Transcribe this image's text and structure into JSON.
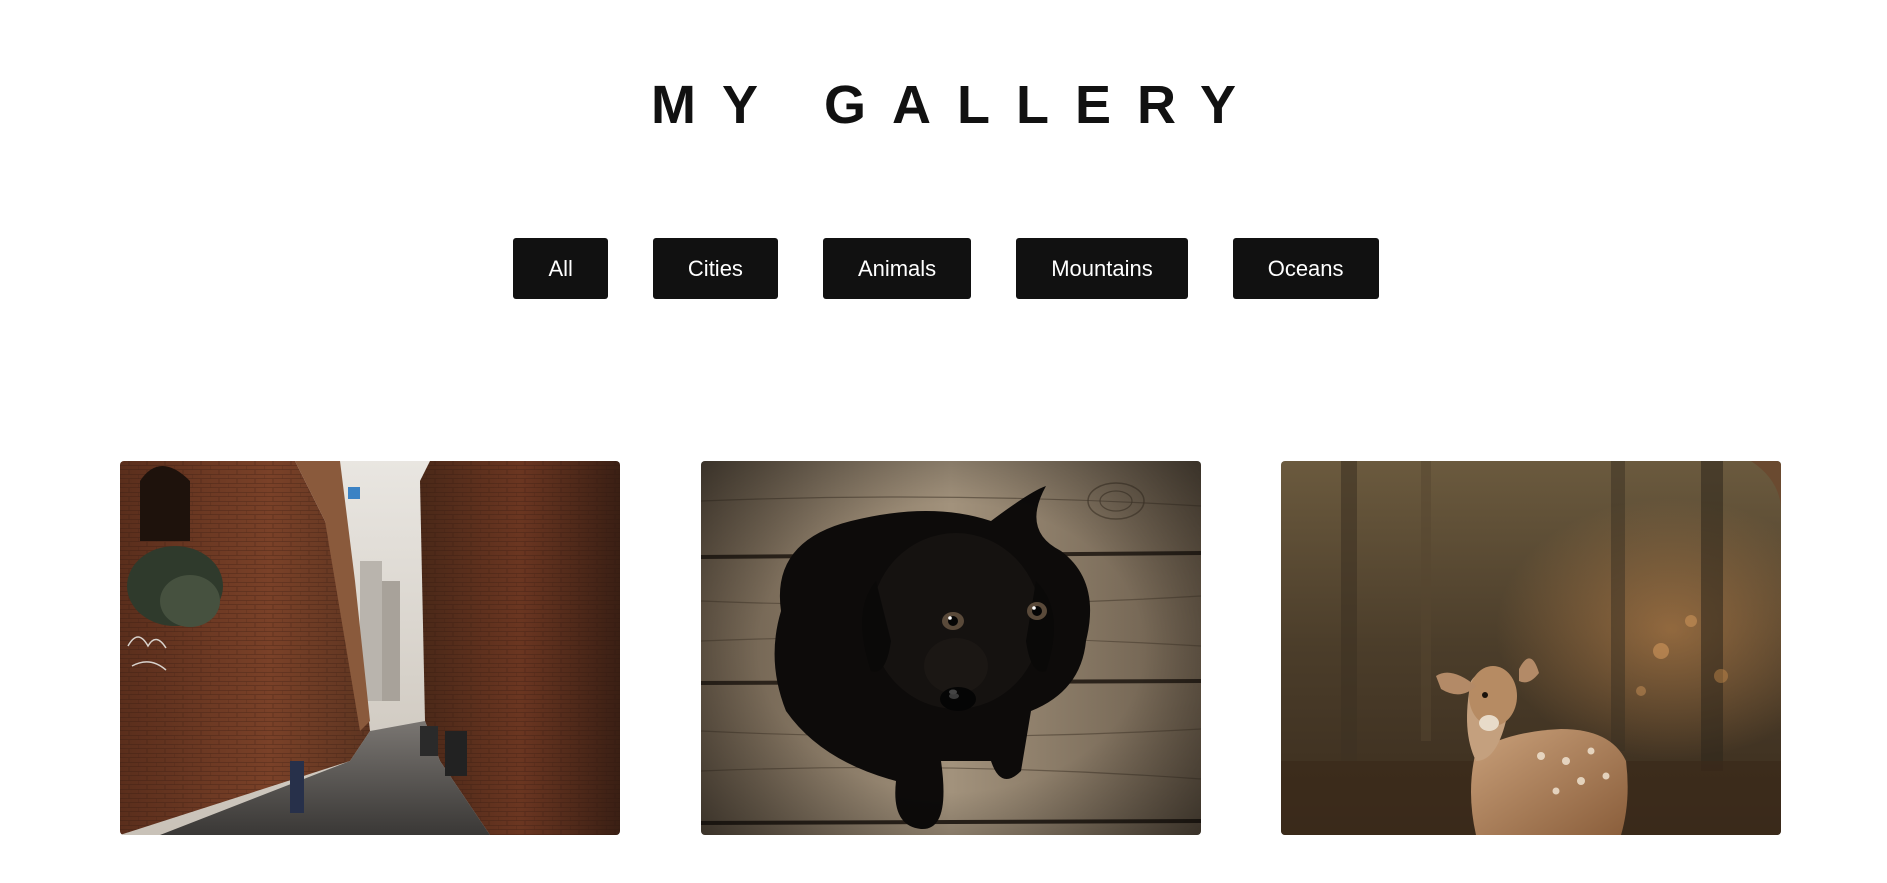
{
  "header": {
    "title": "MY GALLERY"
  },
  "filters": [
    {
      "label": "All"
    },
    {
      "label": "Cities"
    },
    {
      "label": "Animals"
    },
    {
      "label": "Mountains"
    },
    {
      "label": "Oceans"
    }
  ],
  "gallery": {
    "items": [
      {
        "category": "Cities",
        "subject": "alley-photo"
      },
      {
        "category": "Animals",
        "subject": "puppy-photo"
      },
      {
        "category": "Animals",
        "subject": "deer-photo"
      }
    ]
  },
  "colors": {
    "button_bg": "#111111",
    "button_text": "#ffffff",
    "title_text": "#111111",
    "page_bg": "#ffffff"
  }
}
